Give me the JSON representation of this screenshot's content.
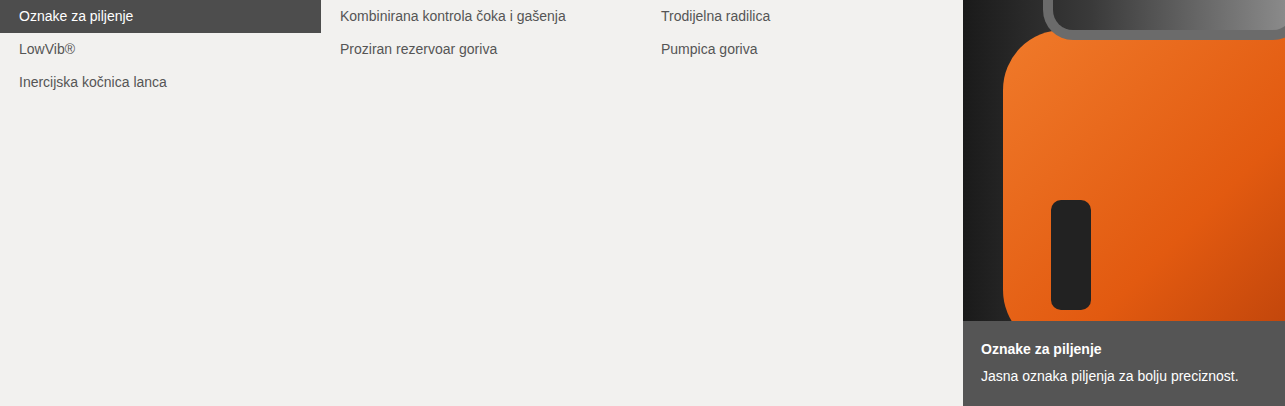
{
  "features": {
    "columns": [
      [
        {
          "label": "Oznake za piljenje",
          "selected": true
        },
        {
          "label": "LowVib®",
          "selected": false
        },
        {
          "label": "Inercijska kočnica lanca",
          "selected": false
        }
      ],
      [
        {
          "label": "Kombinirana kontrola čoka i gašenja",
          "selected": false
        },
        {
          "label": "Proziran rezervoar goriva",
          "selected": false
        }
      ],
      [
        {
          "label": "Trodijelna radilica",
          "selected": false
        },
        {
          "label": "Pumpica goriva",
          "selected": false
        }
      ]
    ]
  },
  "detail": {
    "title": "Oznake za piljenje",
    "description": "Jasna oznaka piljenja za bolju preciznost."
  }
}
